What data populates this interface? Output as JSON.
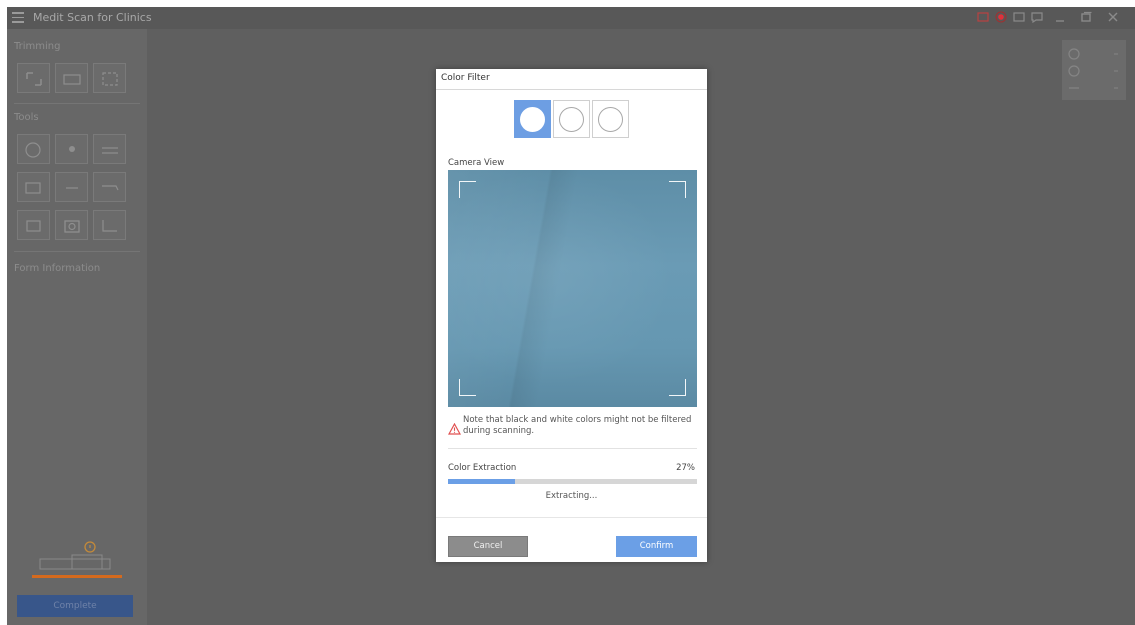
{
  "app": {
    "title": "Medit Scan for Clinics",
    "menu_icon": "hamburger-menu-icon",
    "window_controls": [
      "screen-record-icon",
      "record-icon",
      "screen-icon",
      "chat-icon",
      "minimize-icon",
      "maximize-icon",
      "close-icon"
    ],
    "record_color": "#e0303a"
  },
  "sidebar": {
    "trimming_title": "Trimming",
    "tools_title": "Tools",
    "form_info_title": "Form Information",
    "complete_label": "Complete",
    "trimming_tools": [
      "lasso-select-icon",
      "brush-trim-icon",
      "rectangle-trim-icon"
    ],
    "tools": [
      "lock-tooth-icon",
      "stamp-icon",
      "align-icon",
      "blend-icon",
      "fill-holes-icon",
      "cut-icon",
      "frame-icon",
      "camera-snapshot-icon",
      "measure-icon"
    ]
  },
  "dialog": {
    "title": "Color Filter",
    "modes": [
      {
        "name": "filter-mode-white",
        "active": true
      },
      {
        "name": "filter-mode-outline",
        "active": false
      },
      {
        "name": "filter-mode-empty",
        "active": false
      }
    ],
    "camera_label": "Camera View",
    "warning_icon": "warning-triangle-icon",
    "warning_text": "Note that black and white colors might not be filtered during scanning.",
    "extraction_label": "Color Extraction",
    "extraction_percent_text": "27%",
    "extraction_progress": 0.27,
    "status_text": "Extracting...",
    "cancel_label": "Cancel",
    "confirm_label": "Confirm",
    "accent_color": "#6b9fe6",
    "warning_color": "#e05050"
  }
}
